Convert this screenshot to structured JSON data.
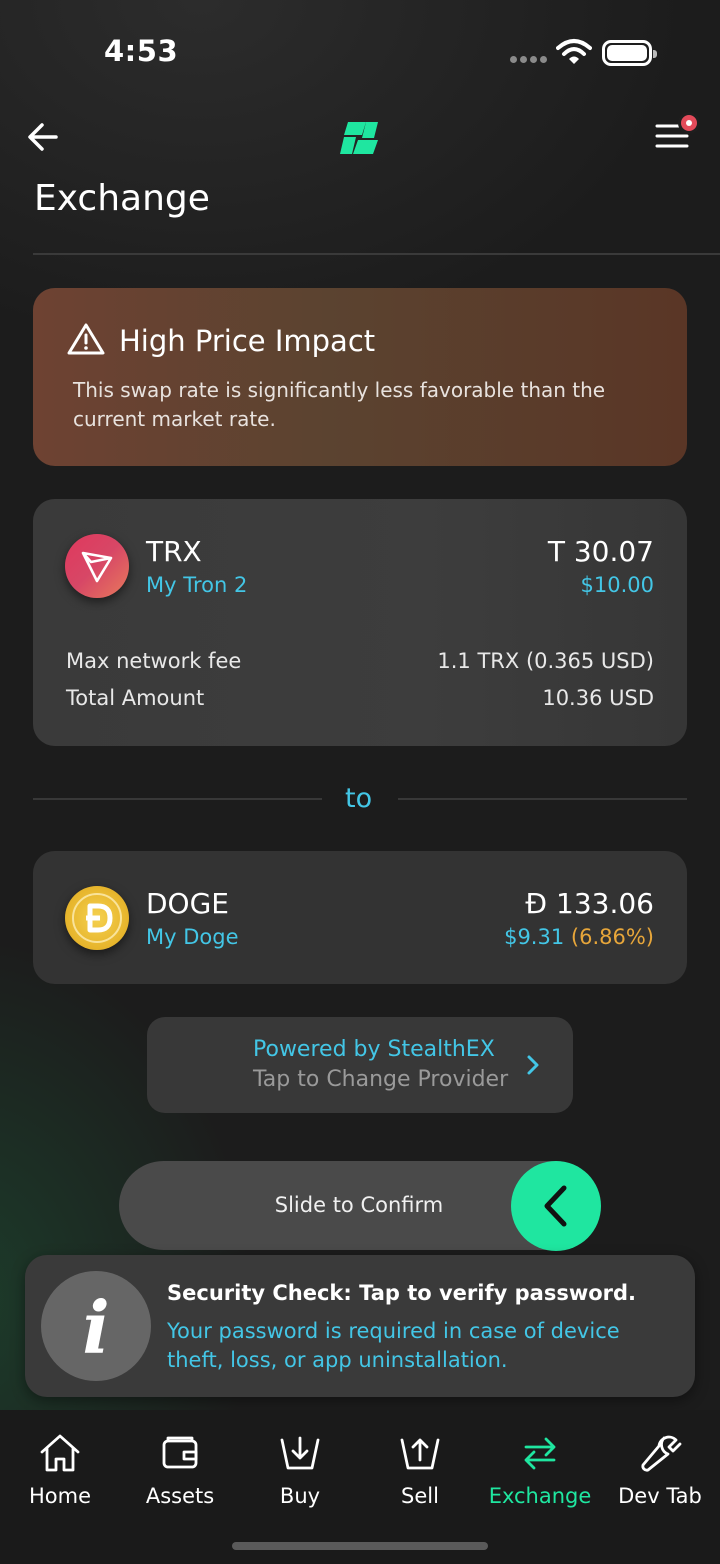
{
  "status_bar": {
    "time": "4:53"
  },
  "header": {
    "title": "Exchange"
  },
  "warning": {
    "title": "High Price Impact",
    "message": "This swap rate is significantly less favorable than the current market rate."
  },
  "from": {
    "symbol": "TRX",
    "wallet": "My Tron 2",
    "amount": "T 30.07",
    "usd": "$10.00",
    "fee_label": "Max network fee",
    "fee_value": "1.1 TRX (0.365 USD)",
    "total_label": "Total Amount",
    "total_value": "10.36 USD"
  },
  "to_label": "to",
  "to": {
    "symbol": "DOGE",
    "wallet": "My Doge",
    "amount": "Đ 133.06",
    "usd": "$9.31",
    "pct": "(6.86%)"
  },
  "provider": {
    "title": "Powered by StealthEX",
    "subtitle": "Tap to Change Provider"
  },
  "slider": {
    "label": "Slide to Confirm"
  },
  "security": {
    "icon_letter": "i",
    "title": "Security Check: Tap to verify password.",
    "message": "Your password is required in case of device theft, loss, or app uninstallation."
  },
  "tabs": [
    {
      "label": "Home",
      "icon": "home-icon"
    },
    {
      "label": "Assets",
      "icon": "wallet-icon"
    },
    {
      "label": "Buy",
      "icon": "buy-icon"
    },
    {
      "label": "Sell",
      "icon": "sell-icon"
    },
    {
      "label": "Exchange",
      "icon": "exchange-icon",
      "active": true
    },
    {
      "label": "Dev Tab",
      "icon": "wrench-icon"
    }
  ],
  "colors": {
    "accent": "#1fe6a0",
    "link": "#43c6e6",
    "warning_pct": "#e7a63a",
    "badge": "#e34a5a"
  }
}
